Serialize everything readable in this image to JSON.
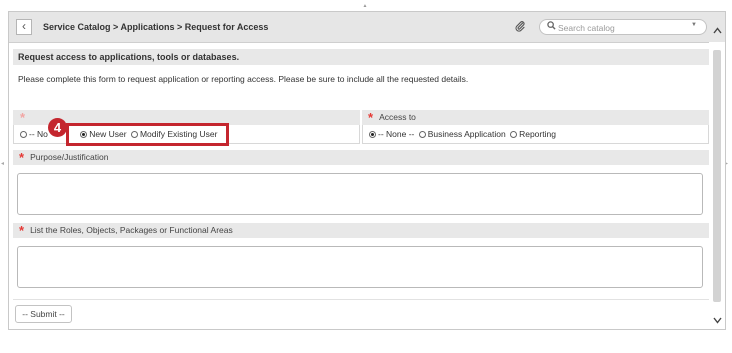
{
  "header": {
    "breadcrumb": "Service Catalog > Applications > Request for Access",
    "back_glyph": "‹",
    "attachment_icon": "paperclip-icon",
    "search_placeholder": "Search catalog"
  },
  "form": {
    "description_title": "Request access to applications, tools or databases.",
    "intro": "Please complete this form to request application or reporting access. Please be sure to include all the requested details.",
    "request_type": {
      "label": "",
      "options": [
        "-- None --",
        "New User",
        "Modify Existing User"
      ],
      "visible_none_text": "-- No",
      "selected": "New User"
    },
    "access_to": {
      "label": "Access to",
      "options": [
        "-- None --",
        "Business Application",
        "Reporting"
      ],
      "selected": "-- None --"
    },
    "purpose": {
      "label": "Purpose/Justification",
      "value": ""
    },
    "roles": {
      "label": "List the Roles, Objects, Packages or Functional Areas",
      "value": ""
    },
    "submit_label": "-- Submit --"
  },
  "annotation": {
    "step_number": "4",
    "color": "#c4262e"
  },
  "colors": {
    "required": "#e53935",
    "header_bg": "#e6e6e6",
    "section_bg": "#e8e8e8"
  }
}
